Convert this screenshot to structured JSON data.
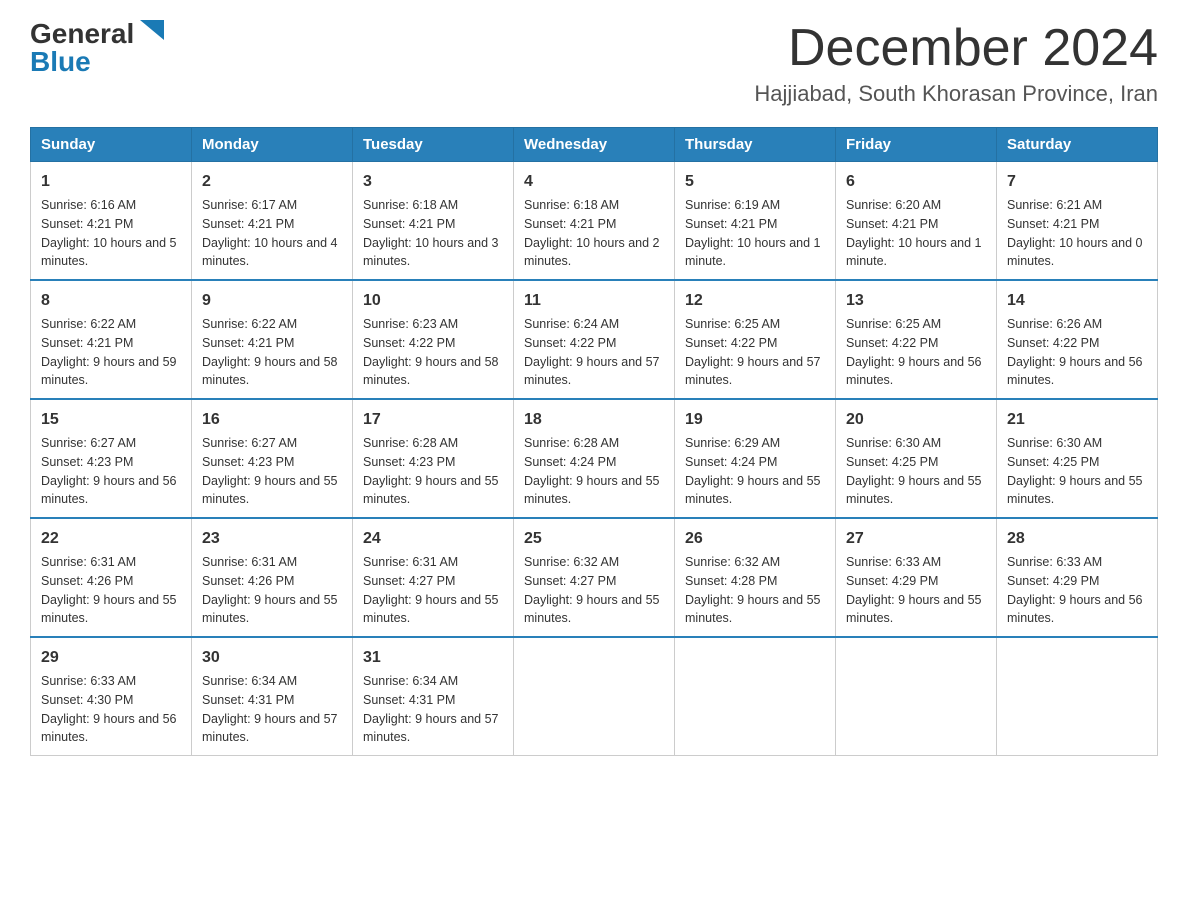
{
  "logo": {
    "general": "General",
    "blue": "Blue",
    "triangle": "▲"
  },
  "header": {
    "month": "December 2024",
    "location": "Hajjiabad, South Khorasan Province, Iran"
  },
  "weekdays": [
    "Sunday",
    "Monday",
    "Tuesday",
    "Wednesday",
    "Thursday",
    "Friday",
    "Saturday"
  ],
  "weeks": [
    [
      {
        "day": "1",
        "sunrise": "6:16 AM",
        "sunset": "4:21 PM",
        "daylight": "10 hours and 5 minutes."
      },
      {
        "day": "2",
        "sunrise": "6:17 AM",
        "sunset": "4:21 PM",
        "daylight": "10 hours and 4 minutes."
      },
      {
        "day": "3",
        "sunrise": "6:18 AM",
        "sunset": "4:21 PM",
        "daylight": "10 hours and 3 minutes."
      },
      {
        "day": "4",
        "sunrise": "6:18 AM",
        "sunset": "4:21 PM",
        "daylight": "10 hours and 2 minutes."
      },
      {
        "day": "5",
        "sunrise": "6:19 AM",
        "sunset": "4:21 PM",
        "daylight": "10 hours and 1 minute."
      },
      {
        "day": "6",
        "sunrise": "6:20 AM",
        "sunset": "4:21 PM",
        "daylight": "10 hours and 1 minute."
      },
      {
        "day": "7",
        "sunrise": "6:21 AM",
        "sunset": "4:21 PM",
        "daylight": "10 hours and 0 minutes."
      }
    ],
    [
      {
        "day": "8",
        "sunrise": "6:22 AM",
        "sunset": "4:21 PM",
        "daylight": "9 hours and 59 minutes."
      },
      {
        "day": "9",
        "sunrise": "6:22 AM",
        "sunset": "4:21 PM",
        "daylight": "9 hours and 58 minutes."
      },
      {
        "day": "10",
        "sunrise": "6:23 AM",
        "sunset": "4:22 PM",
        "daylight": "9 hours and 58 minutes."
      },
      {
        "day": "11",
        "sunrise": "6:24 AM",
        "sunset": "4:22 PM",
        "daylight": "9 hours and 57 minutes."
      },
      {
        "day": "12",
        "sunrise": "6:25 AM",
        "sunset": "4:22 PM",
        "daylight": "9 hours and 57 minutes."
      },
      {
        "day": "13",
        "sunrise": "6:25 AM",
        "sunset": "4:22 PM",
        "daylight": "9 hours and 56 minutes."
      },
      {
        "day": "14",
        "sunrise": "6:26 AM",
        "sunset": "4:22 PM",
        "daylight": "9 hours and 56 minutes."
      }
    ],
    [
      {
        "day": "15",
        "sunrise": "6:27 AM",
        "sunset": "4:23 PM",
        "daylight": "9 hours and 56 minutes."
      },
      {
        "day": "16",
        "sunrise": "6:27 AM",
        "sunset": "4:23 PM",
        "daylight": "9 hours and 55 minutes."
      },
      {
        "day": "17",
        "sunrise": "6:28 AM",
        "sunset": "4:23 PM",
        "daylight": "9 hours and 55 minutes."
      },
      {
        "day": "18",
        "sunrise": "6:28 AM",
        "sunset": "4:24 PM",
        "daylight": "9 hours and 55 minutes."
      },
      {
        "day": "19",
        "sunrise": "6:29 AM",
        "sunset": "4:24 PM",
        "daylight": "9 hours and 55 minutes."
      },
      {
        "day": "20",
        "sunrise": "6:30 AM",
        "sunset": "4:25 PM",
        "daylight": "9 hours and 55 minutes."
      },
      {
        "day": "21",
        "sunrise": "6:30 AM",
        "sunset": "4:25 PM",
        "daylight": "9 hours and 55 minutes."
      }
    ],
    [
      {
        "day": "22",
        "sunrise": "6:31 AM",
        "sunset": "4:26 PM",
        "daylight": "9 hours and 55 minutes."
      },
      {
        "day": "23",
        "sunrise": "6:31 AM",
        "sunset": "4:26 PM",
        "daylight": "9 hours and 55 minutes."
      },
      {
        "day": "24",
        "sunrise": "6:31 AM",
        "sunset": "4:27 PM",
        "daylight": "9 hours and 55 minutes."
      },
      {
        "day": "25",
        "sunrise": "6:32 AM",
        "sunset": "4:27 PM",
        "daylight": "9 hours and 55 minutes."
      },
      {
        "day": "26",
        "sunrise": "6:32 AM",
        "sunset": "4:28 PM",
        "daylight": "9 hours and 55 minutes."
      },
      {
        "day": "27",
        "sunrise": "6:33 AM",
        "sunset": "4:29 PM",
        "daylight": "9 hours and 55 minutes."
      },
      {
        "day": "28",
        "sunrise": "6:33 AM",
        "sunset": "4:29 PM",
        "daylight": "9 hours and 56 minutes."
      }
    ],
    [
      {
        "day": "29",
        "sunrise": "6:33 AM",
        "sunset": "4:30 PM",
        "daylight": "9 hours and 56 minutes."
      },
      {
        "day": "30",
        "sunrise": "6:34 AM",
        "sunset": "4:31 PM",
        "daylight": "9 hours and 57 minutes."
      },
      {
        "day": "31",
        "sunrise": "6:34 AM",
        "sunset": "4:31 PM",
        "daylight": "9 hours and 57 minutes."
      },
      null,
      null,
      null,
      null
    ]
  ],
  "labels": {
    "sunrise": "Sunrise:",
    "sunset": "Sunset:",
    "daylight": "Daylight:"
  }
}
